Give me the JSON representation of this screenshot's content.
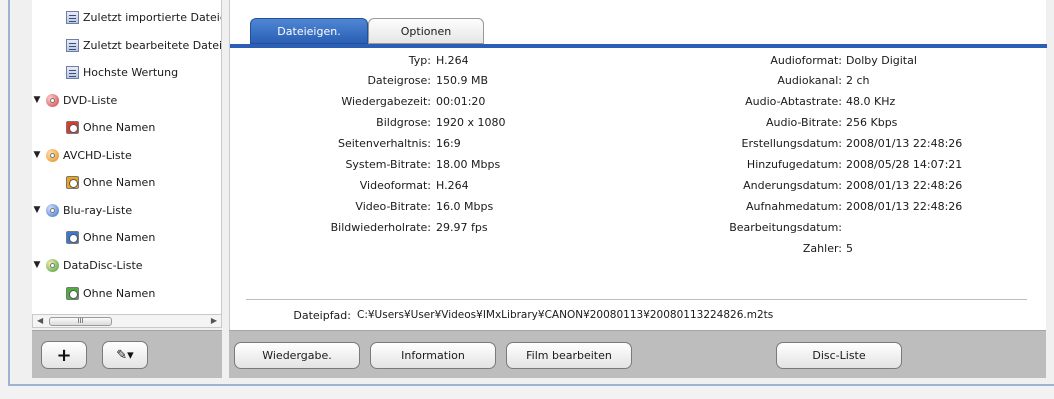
{
  "tree": {
    "items": [
      {
        "label": "Zuletzt importierte Dateien",
        "icon": "list-icon",
        "level": 1
      },
      {
        "label": "Zuletzt bearbeitete Dateien",
        "icon": "list-icon",
        "level": 1
      },
      {
        "label": "Hochste Wertung",
        "icon": "list-icon",
        "level": 1
      },
      {
        "label": "DVD-Liste",
        "icon": "dvd-disc-icon",
        "level": 0,
        "toggle": "▼"
      },
      {
        "label": "Ohne Namen",
        "icon": "dvd-item-icon",
        "level": 1
      },
      {
        "label": "AVCHD-Liste",
        "icon": "avchd-disc-icon",
        "level": 0,
        "toggle": "▼"
      },
      {
        "label": "Ohne Namen",
        "icon": "avchd-item-icon",
        "level": 1
      },
      {
        "label": "Blu-ray-Liste",
        "icon": "bluray-disc-icon",
        "level": 0,
        "toggle": "▼"
      },
      {
        "label": "Ohne Namen",
        "icon": "bluray-item-icon",
        "level": 1
      },
      {
        "label": "DataDisc-Liste",
        "icon": "datadisc-icon",
        "level": 0,
        "toggle": "▼"
      },
      {
        "label": "Ohne Namen",
        "icon": "datadisc-item-icon",
        "level": 1
      }
    ],
    "scroll_thumb_glyph": "III",
    "scroll_left": "◀",
    "scroll_right": "▶"
  },
  "left_toolbar": {
    "add_glyph": "+",
    "tools_glyph": "✎▾"
  },
  "tabs": [
    {
      "label": "Dateieigen.",
      "active": true
    },
    {
      "label": "Optionen",
      "active": false
    }
  ],
  "properties_left": [
    {
      "key": "Typ:",
      "value": "H.264"
    },
    {
      "key": "Dateigrose:",
      "value": "150.9 MB"
    },
    {
      "key": "Wiedergabezeit:",
      "value": "00:01:20"
    },
    {
      "key": "Bildgrose:",
      "value": "1920 x 1080"
    },
    {
      "key": "Seitenverhaltnis:",
      "value": "16:9"
    },
    {
      "key": "System-Bitrate:",
      "value": "18.00 Mbps"
    },
    {
      "key": "Videoformat:",
      "value": "H.264"
    },
    {
      "key": "Video-Bitrate:",
      "value": "16.0 Mbps"
    },
    {
      "key": "Bildwiederholrate:",
      "value": "29.97 fps"
    }
  ],
  "properties_right": [
    {
      "key": "Audioformat:",
      "value": "Dolby Digital"
    },
    {
      "key": "Audiokanal:",
      "value": "2 ch"
    },
    {
      "key": "Audio-Abtastrate:",
      "value": "48.0 KHz"
    },
    {
      "key": "Audio-Bitrate:",
      "value": "256 Kbps"
    },
    {
      "key": "Erstellungsdatum:",
      "value": "2008/01/13 22:48:26"
    },
    {
      "key": "Hinzufugedatum:",
      "value": "2008/05/28 14:07:21"
    },
    {
      "key": "Anderungsdatum:",
      "value": "2008/01/13 22:48:26"
    },
    {
      "key": "Aufnahmedatum:",
      "value": "2008/01/13 22:48:26"
    },
    {
      "key": "Bearbeitungsdatum:",
      "value": ""
    },
    {
      "key": "Zahler:",
      "value": "5"
    }
  ],
  "filepath": {
    "label": "Dateipfad:",
    "value": "C:¥Users¥User¥Videos¥IMxLibrary¥CANON¥20080113¥20080113224826.m2ts"
  },
  "buttons": {
    "play": "Wiedergabe.",
    "information": "Information",
    "edit_movie": "Film bearbeiten",
    "disc_list": "Disc-Liste"
  },
  "colors": {
    "tab_active": "#2a5fb5",
    "panel_bar": "#bdbdbd",
    "dvd": "#d23b3b",
    "avchd": "#e08a12",
    "bluray": "#3a6fc4",
    "datadisc": "#3a9a3a"
  }
}
